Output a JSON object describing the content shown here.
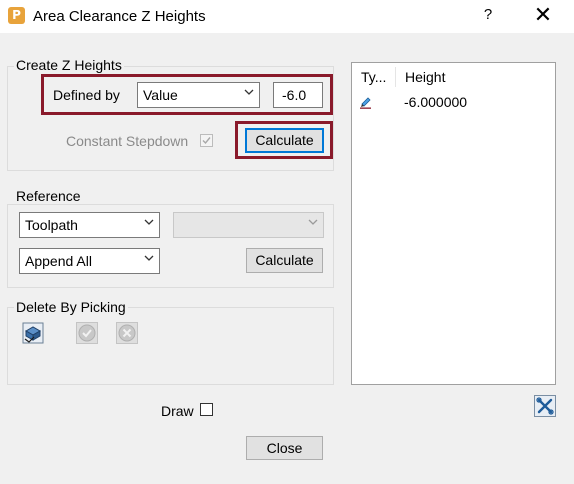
{
  "window": {
    "title": "Area Clearance Z Heights",
    "help_label": "?",
    "close_glyph": "✕"
  },
  "create_z_heights": {
    "group_label": "Create Z Heights",
    "defined_by_label": "Defined by",
    "defined_by_value": "Value",
    "value_input": "-6.0",
    "constant_stepdown_label": "Constant Stepdown",
    "constant_stepdown_checked": true,
    "calculate_label": "Calculate"
  },
  "reference": {
    "group_label": "Reference",
    "source_value": "Toolpath",
    "secondary_value": "",
    "mode_value": "Append All",
    "calculate_label": "Calculate"
  },
  "delete_by_picking": {
    "group_label": "Delete By Picking"
  },
  "draw": {
    "label": "Draw",
    "checked": false
  },
  "close_label": "Close",
  "table": {
    "columns": [
      "Ty...",
      "Height"
    ],
    "rows": [
      {
        "type_icon": "pencil-icon",
        "height": "-6.000000"
      }
    ]
  },
  "colors": {
    "highlight": "#8a1a2b",
    "focus": "#0078d7"
  }
}
